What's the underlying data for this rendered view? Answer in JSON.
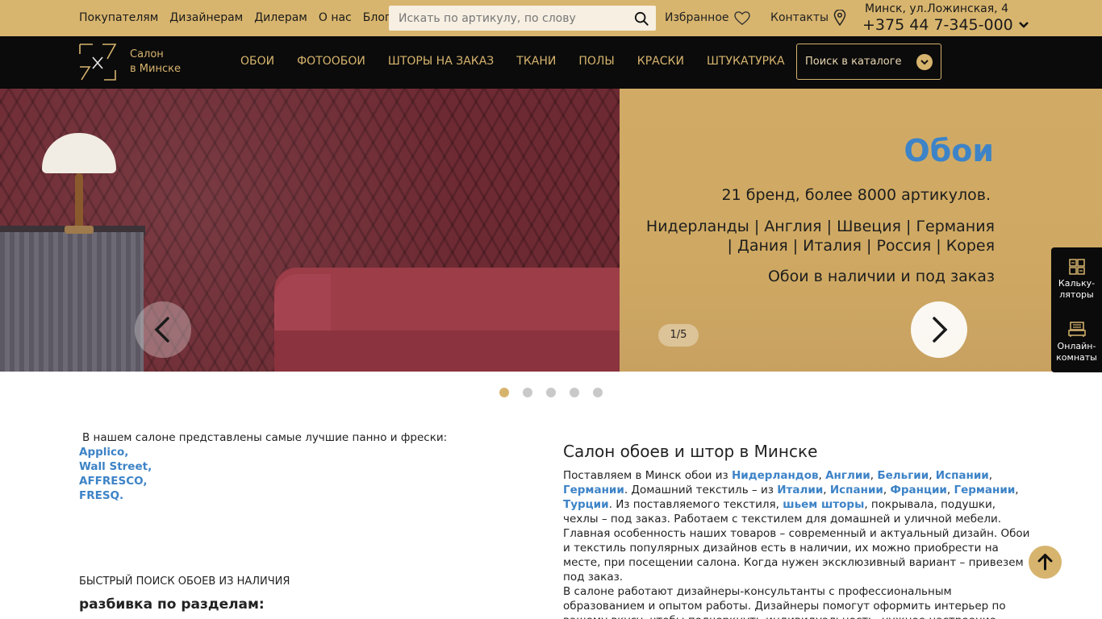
{
  "topbar": {
    "links": [
      "Покупателям",
      "Дизайнерам",
      "Дилерам",
      "О нас",
      "Блог"
    ],
    "search_placeholder": "Искать по артикулу, по слову",
    "favorites": "Избранное",
    "contacts": "Контакты",
    "address": "Минск, ул.Ложинская, 4",
    "phone": "+375 44 7-345-000"
  },
  "navbar": {
    "salon_line1": "Салон",
    "salon_line2": "в Минске",
    "items": [
      "ОБОИ",
      "ФОТООБОИ",
      "ШТОРЫ НА ЗАКАЗ",
      "ТКАНИ",
      "ПОЛЫ",
      "КРАСКИ",
      "ШТУКАТУРКА"
    ],
    "catalog_label": "Поиск в каталоге"
  },
  "hero": {
    "title": "Обои",
    "line1": "21 бренд, более 8000 артикулов.",
    "line2": "Нидерланды | Англия | Швеция | Германия | Дания | Италия | Россия | Корея",
    "line3": "Обои в наличии и под заказ",
    "counter": "1/5",
    "dots_total": 5,
    "dots_active": 1
  },
  "sidepanel": {
    "calc_label_1": "Кальку-",
    "calc_label_2": "ляторы",
    "online_label_1": "Онлайн-",
    "online_label_2": "комнаты"
  },
  "intro": {
    "text": "В нашем салоне представлены самые лучшие панно и фрески:",
    "brands": [
      "Applico,",
      "Wall Street,",
      "AFFRESCO,",
      "FRESQ."
    ]
  },
  "quick": {
    "label": "БЫСТРЫЙ ПОИСК ОБОЕВ ИЗ НАЛИЧИЯ",
    "subtitle": "разбивка по разделам:"
  },
  "article": {
    "title": "Салон обоев и штор в Минске",
    "p1_start": "Поставляем в Минск обои из ",
    "wall_countries": [
      "Нидерландов",
      "Англии",
      "Бельгии",
      "Испании",
      "Германии"
    ],
    "p1_mid": ". Домашний текстиль – из ",
    "textile_countries": [
      "Италии",
      "Испании",
      "Франции",
      "Германии",
      "Турции"
    ],
    "p1_sew_pre": ". Из поставляемого текстиля, ",
    "p1_sew_link": "шьем шторы",
    "p1_end": ", покрывала, подушки, чехлы – под заказ. Работаем с текстилем для домашней и уличной мебели.",
    "p2": "Главная особенность наших товаров – современный и актуальный дизайн. Обои и текстиль популярных дизайнов есть в наличии, их можно приобрести на месте, при посещении салона. Когда нужен эксклюзивный вариант – привезем под заказ.",
    "p3": "В салоне работают дизайнеры-консультанты с профессиональным образованием и опытом работы. Дизайнеры помогут оформить интерьер по вашему вкусу, чтобы подчеркнуть индивидуальность, нужное настроение, эмоции. Как это работает –"
  },
  "colors": {
    "gold": "#d7b46e",
    "black": "#0b0b0b",
    "link_blue": "#3d83c7"
  }
}
